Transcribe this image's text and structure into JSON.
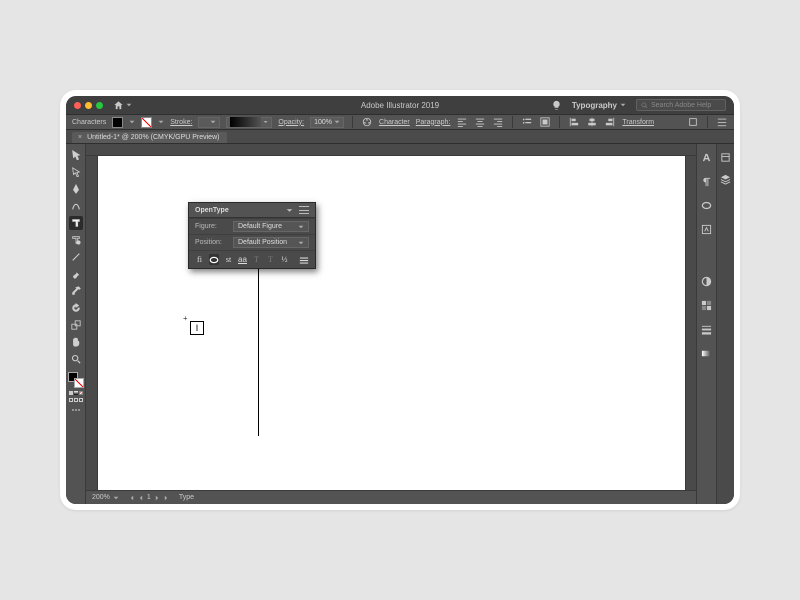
{
  "titlebar": {
    "title": "Adobe Illustrator 2019",
    "workspace": "Typography",
    "search_placeholder": "Search Adobe Help"
  },
  "ctrl": {
    "left_label": "Characters",
    "stroke": "Stroke:",
    "opacity_lbl": "Opacity:",
    "opacity_val": "100%",
    "character": "Character",
    "paragraph": "Paragraph:",
    "transform": "Transform"
  },
  "tab": {
    "label": "Untitled-1* @ 200% (CMYK/GPU Preview)",
    "close": "×"
  },
  "panel": {
    "title": "OpenType",
    "rows": {
      "figure_k": "Figure:",
      "figure_v": "Default Figure",
      "position_k": "Position:",
      "position_v": "Default Position"
    },
    "icons": [
      "fi",
      "𝑂",
      "st",
      "aa",
      "T",
      "T",
      "½"
    ]
  },
  "cursor_glyph": "I",
  "status": {
    "zoom": "200%",
    "artboard_nav": "1",
    "tool": "Type"
  }
}
